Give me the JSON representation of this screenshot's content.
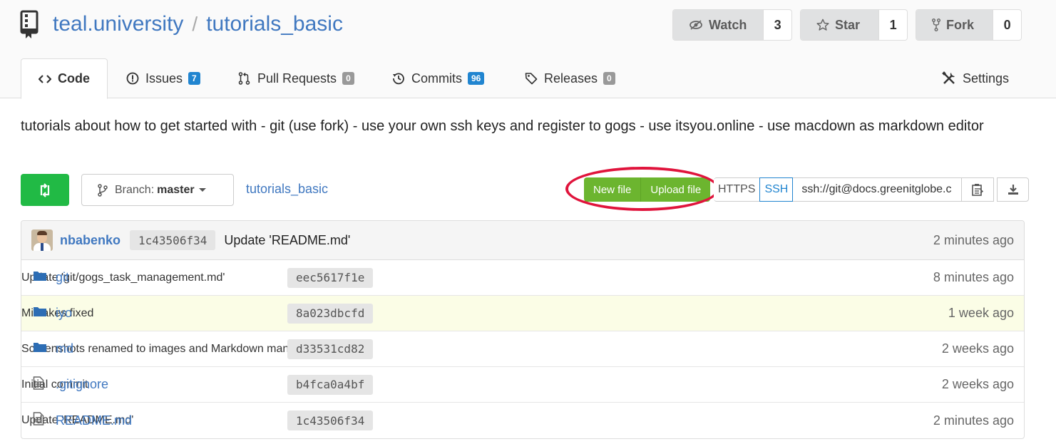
{
  "repo": {
    "owner": "teal.university",
    "separator": "/",
    "name": "tutorials_basic"
  },
  "actions": {
    "watch": {
      "label": "Watch",
      "count": "3"
    },
    "star": {
      "label": "Star",
      "count": "1"
    },
    "fork": {
      "label": "Fork",
      "count": "0"
    }
  },
  "tabs": [
    {
      "label": "Code"
    },
    {
      "label": "Issues",
      "badge": "7"
    },
    {
      "label": "Pull Requests",
      "badge": "0"
    },
    {
      "label": "Commits",
      "badge": "96"
    },
    {
      "label": "Releases",
      "badge": "0"
    },
    {
      "label": "Settings"
    }
  ],
  "description": "tutorials about how to get started with - git (use fork) - use your own ssh keys and register to gogs - use itsyou.online - use macdown as markdown editor",
  "toolbar": {
    "branch_prefix": "Branch:",
    "branch": "master",
    "path": "tutorials_basic",
    "new_file": "New file",
    "upload_file": "Upload file",
    "https": "HTTPS",
    "ssh": "SSH",
    "clone_url": "ssh://git@docs.greenitglobe.c"
  },
  "colors": {
    "link": "#4078c0",
    "green": "#21ba45",
    "olive": "#6cb52f",
    "highlight": "#e0143c"
  },
  "last_commit": {
    "author": "nbabenko",
    "sha": "1c43506f34",
    "message": "Update 'README.md'",
    "age": "2 minutes ago"
  },
  "files": [
    {
      "type": "folder",
      "name": "git",
      "sha": "eec5617f1e",
      "message": "Update 'git/gogs_task_management.md'",
      "age": "8 minutes ago"
    },
    {
      "type": "folder",
      "name": "iyo",
      "sha": "8a023dbcfd",
      "message": "Mistakes fixed",
      "age": "1 week ago"
    },
    {
      "type": "folder",
      "name": "md",
      "sha": "d33531cd82",
      "message": "Screenshots renamed to images and Markdown manual added",
      "age": "2 weeks ago"
    },
    {
      "type": "file",
      "name": ".gitignore",
      "sha": "b4fca0a4bf",
      "message": "Initial commit",
      "age": "2 weeks ago"
    },
    {
      "type": "file",
      "name": "README.md",
      "sha": "1c43506f34",
      "message": "Update 'README.md'",
      "age": "2 minutes ago"
    }
  ]
}
